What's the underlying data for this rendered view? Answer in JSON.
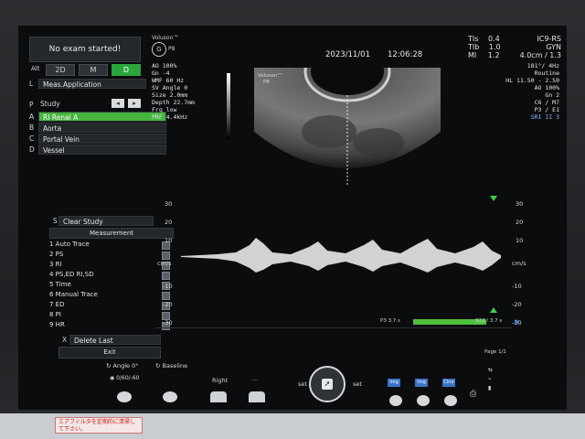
{
  "header": {
    "logo_text": "Voluson™",
    "probe": "P8",
    "date": "2023/11/01",
    "time": "12:06:28",
    "tis_label": "TIs",
    "tis_value": "0.4",
    "tib_label": "TIb",
    "tib_value": "1.0",
    "mi_label": "MI",
    "mi_value": "1.2",
    "probe_model": "IC9-RS",
    "preset": "GYN",
    "depth_zoom": "4.0cm / 1.3"
  },
  "left_params": [
    "AO 100%",
    "Gn  -4",
    "WMF 60 Hz",
    "SV Angle  0",
    "Size  2.0mm",
    "Depth 22.7mm",
    "Frq low",
    "PRF  4.4kHz"
  ],
  "right_params": [
    "181°/ 4Hz",
    "Routine",
    "HL  11.50 - 2.50",
    "AO 100%",
    "Gn  2",
    "C6 / M7",
    "P3 / E1",
    "SRI II 3"
  ],
  "left_panel": {
    "status": "No exam started!",
    "mode_alt": "Alt",
    "modes": [
      "2D",
      "M",
      "D"
    ],
    "meas_key": "L",
    "meas_app": "Meas.Application",
    "study_key": "P",
    "study_label": "Study",
    "study_items": [
      {
        "key": "A",
        "label": "RI Renal A"
      },
      {
        "key": "B",
        "label": "Aorta"
      },
      {
        "key": "C",
        "label": "Portal Vein"
      },
      {
        "key": "D",
        "label": "Vessel"
      }
    ],
    "clear_key": "S",
    "clear_label": "Clear Study",
    "measurement_title": "Measurement",
    "measurements": [
      "1  Auto Trace",
      "2  PS",
      "3  RI",
      "4  PS,ED RI,SD",
      "5  Time",
      "6  Manual Trace",
      "7  ED",
      "8  PI",
      "9  HR"
    ],
    "delete_key": "X",
    "delete_label": "Delete Last",
    "exit_label": "Exit"
  },
  "doppler": {
    "unit": "cm/s",
    "ticks": [
      "30",
      "20",
      "10",
      "-10",
      "-20",
      "-30"
    ],
    "bar_left": "P3  3.7 s",
    "bar_right": "922 / 3.7 s",
    "page": "Page 1/1"
  },
  "bottom_bar": {
    "angle": "Angle 0°",
    "angle_values": "0/60/-60",
    "baseline": "Baseline",
    "right": "Right",
    "dots": "...",
    "set_left": "set",
    "set_right": "set"
  },
  "sticker_text": "エアフィルタを定期的に清掃して下さい。"
}
